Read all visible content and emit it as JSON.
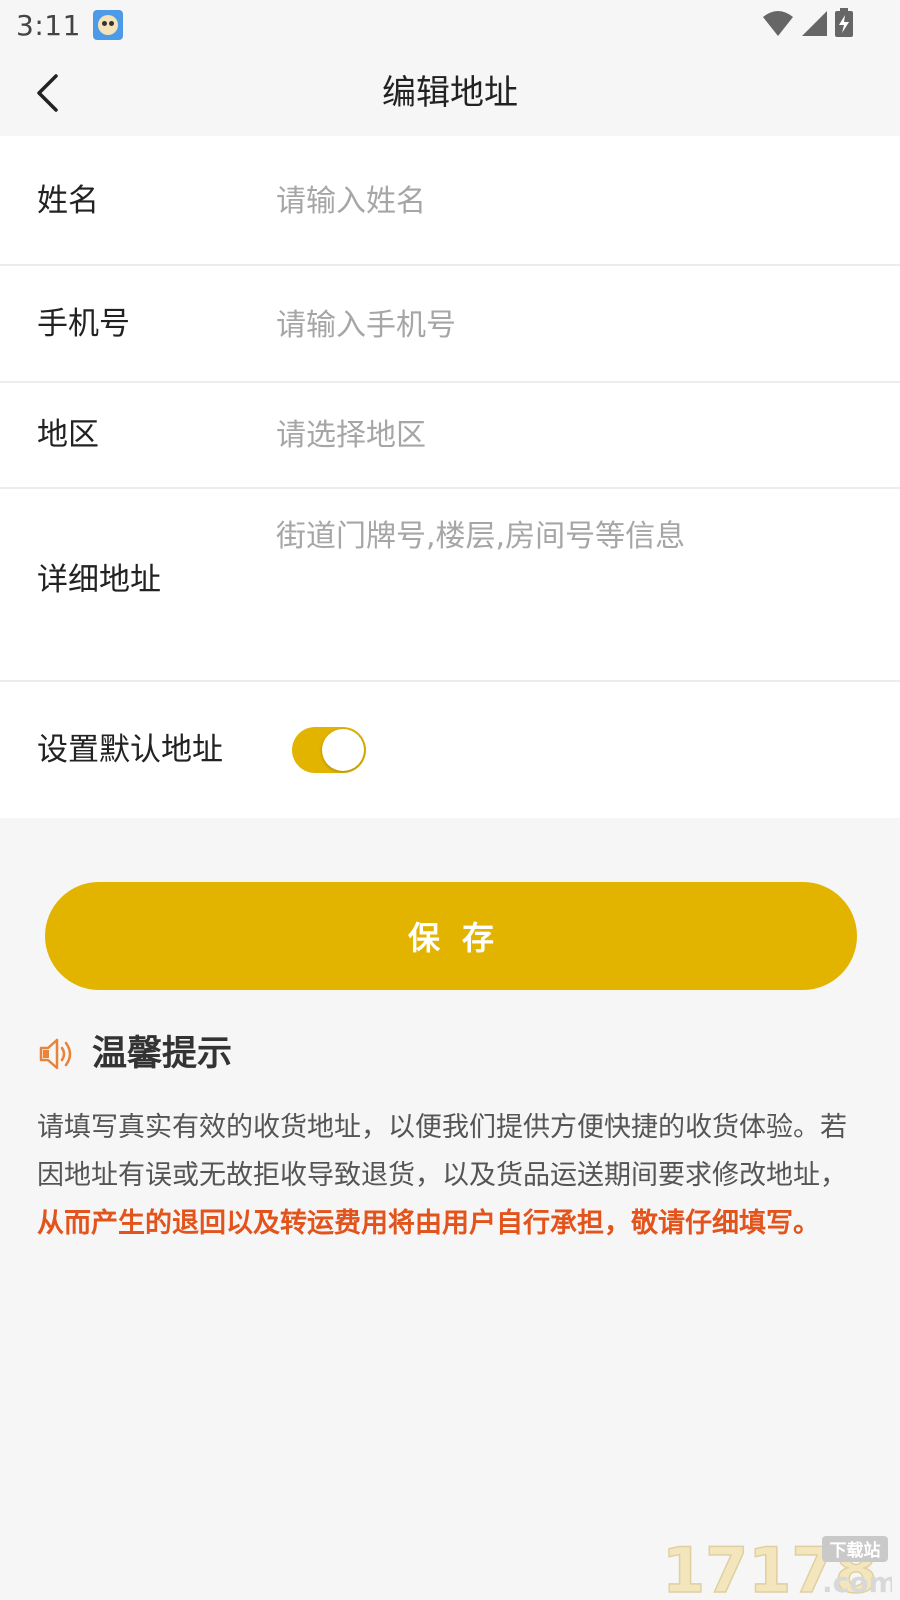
{
  "status_bar": {
    "time": "3:11"
  },
  "header": {
    "title": "编辑地址"
  },
  "form": {
    "name": {
      "label": "姓名",
      "placeholder": "请输入姓名",
      "value": ""
    },
    "phone": {
      "label": "手机号",
      "placeholder": "请输入手机号",
      "value": ""
    },
    "region": {
      "label": "地区",
      "placeholder": "请选择地区",
      "value": ""
    },
    "detail": {
      "label": "详细地址",
      "placeholder": "街道门牌号,楼层,房间号等信息",
      "value": ""
    },
    "default_address": {
      "label": "设置默认地址",
      "enabled": true
    }
  },
  "save_button": {
    "label": "保存"
  },
  "tips": {
    "title": "温馨提示",
    "text_normal": "请填写真实有效的收货地址，以便我们提供方便快捷的收货体验。若因地址有误或无故拒收导致退货，以及货品运送期间要求修改地址，",
    "text_highlight": "从而产生的退回以及转运费用将由用户自行承担，敬请仔细填写。"
  },
  "watermark": {
    "brand": "17178",
    "suffix": ".com",
    "badge": "下载站"
  },
  "colors": {
    "accent": "#e2b400",
    "warning_text": "#e3541c",
    "tips_icon": "#e8833a"
  }
}
